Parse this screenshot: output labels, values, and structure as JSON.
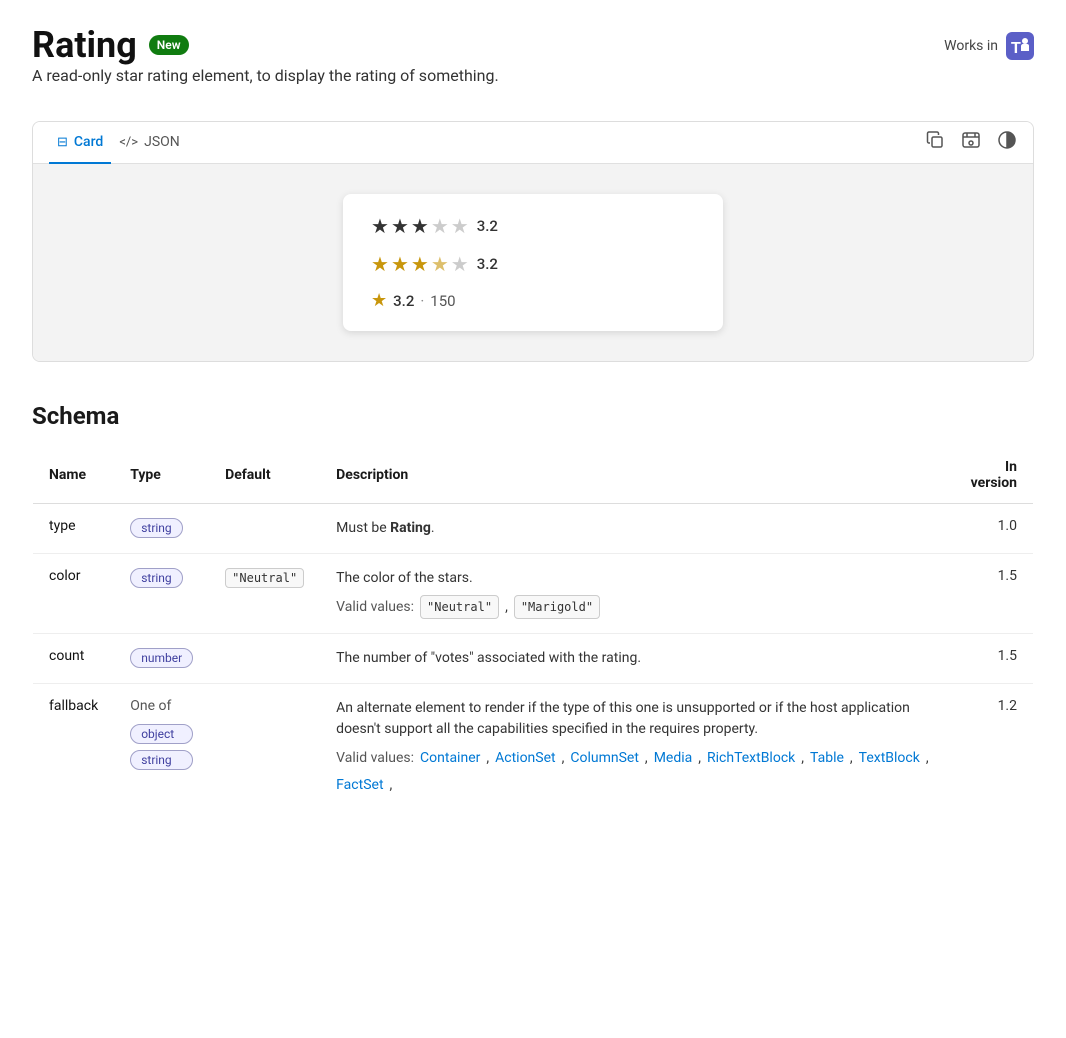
{
  "header": {
    "title": "Rating",
    "badge": "New",
    "subtitle": "A read-only star rating element, to display the rating of something.",
    "works_in_label": "Works in"
  },
  "tabs": {
    "card_label": "Card",
    "json_label": "JSON"
  },
  "toolbar": {
    "copy_icon": "⧉",
    "preview_icon": "⊡",
    "theme_icon": "◑"
  },
  "card_preview": {
    "rows": [
      {
        "style": "neutral",
        "value": "3.2",
        "filled": 3,
        "empty": 2
      },
      {
        "style": "gold",
        "value": "3.2",
        "filled": 3,
        "half": 1,
        "empty": 1
      },
      {
        "style": "compact",
        "value": "3.2",
        "count": "150"
      }
    ]
  },
  "schema": {
    "title": "Schema",
    "columns": [
      "Name",
      "Type",
      "Default",
      "Description",
      "In version"
    ],
    "rows": [
      {
        "name": "type",
        "type": "string",
        "default": "",
        "description_parts": [
          {
            "text": "Must be "
          },
          {
            "text": "Rating",
            "bold": true
          },
          {
            "text": "."
          }
        ],
        "version": "1.0"
      },
      {
        "name": "color",
        "type": "string",
        "default": "\"Neutral\"",
        "description": "The color of the stars.",
        "valid_values_label": "Valid values:",
        "valid_values": [
          "\"Neutral\"",
          "\"Marigold\""
        ],
        "version": "1.5"
      },
      {
        "name": "count",
        "type": "number",
        "default": "",
        "description": "The number of \"votes\" associated with the rating.",
        "version": "1.5"
      },
      {
        "name": "fallback",
        "type_oneof": [
          "object",
          "string"
        ],
        "type_label": "One of",
        "default": "",
        "description": "An alternate element to render if the type of this one is unsupported or if the host application doesn't support all the capabilities specified in the requires property.",
        "valid_values_label": "Valid values:",
        "valid_values_links": [
          "Container",
          "ActionSet",
          "ColumnSet",
          "Media",
          "RichTextBlock",
          "Table",
          "TextBlock",
          "FactSet,"
        ],
        "version": "1.2"
      }
    ]
  }
}
